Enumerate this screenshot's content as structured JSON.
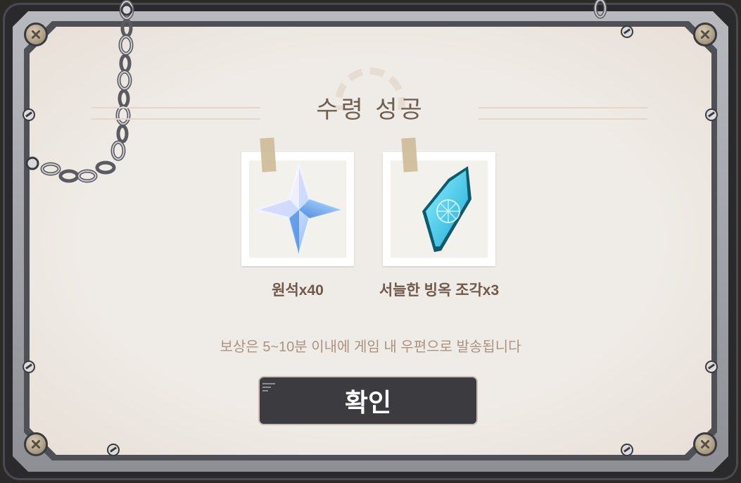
{
  "dialog": {
    "title": "수령 성공",
    "rewards": [
      {
        "label": "원석x40",
        "icon": "primogem-icon"
      },
      {
        "label": "서늘한 빙옥 조각x3",
        "icon": "cryo-gem-fragment-icon"
      }
    ],
    "note": "보상은 5~10분 이내에 게임 내 우편으로 발송됩니다",
    "confirm_label": "확인"
  },
  "colors": {
    "paper": "#efebe6",
    "title_text": "#6f5f51",
    "label_text": "#6f5a4b",
    "note_text": "#ab9383",
    "button_bg": "#3c3b3f"
  }
}
